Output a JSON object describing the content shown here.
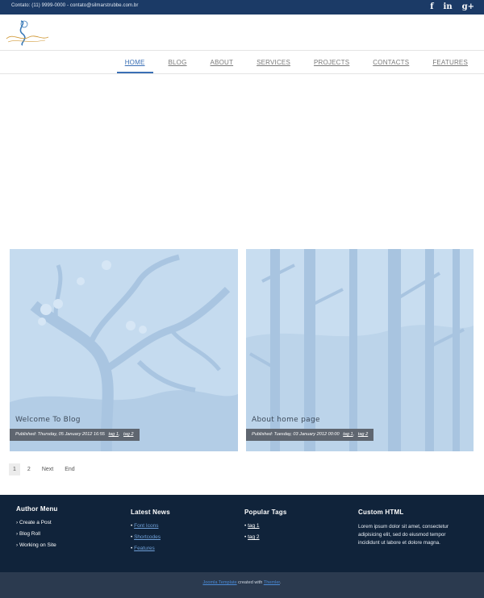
{
  "topbar": {
    "contact": "Contato: (11) 9999-0000  -  contato@silmarstrubbe.com.br",
    "social": [
      {
        "icon": "facebook-icon",
        "glyph": "f"
      },
      {
        "icon": "linkedin-icon",
        "glyph": "in"
      },
      {
        "icon": "google-plus-icon",
        "glyph": "g+"
      }
    ]
  },
  "nav": {
    "items": [
      "HOME",
      "BLOG",
      "ABOUT",
      "SERVICES",
      "PROJECTS",
      "CONTACTS",
      "FEATURES"
    ]
  },
  "posts": [
    {
      "title": "Welcome To Blog",
      "meta": "Published: Thursday, 05 January 2012 16:55",
      "tag1": "tag 1",
      "tag2": "tag 2"
    },
    {
      "title": "About home page",
      "meta": "Published: Tuesday, 03 January 2012 00:00",
      "tag1": "tag 1",
      "tag2": "tag 2"
    }
  ],
  "pagination": [
    "1",
    "2",
    "Next",
    "End"
  ],
  "footer": {
    "author_menu": {
      "title": "Author Menu",
      "items": [
        "Create a Post",
        "Blog Roll",
        "Working on Site"
      ]
    },
    "latest_news": {
      "title": "Latest News",
      "items": [
        "Font Icons",
        "Shortcodes",
        "Features"
      ]
    },
    "popular_tags": {
      "title": "Popular Tags",
      "items": [
        "tag 1",
        "tag 2"
      ]
    },
    "custom_html": {
      "title": "Custom HTML",
      "text": "Lorem ipsum dolor sit amet, consectetur adipisicing elit, sed do eiusmod tempor incididunt ut labore et dolore magna."
    }
  },
  "bottom": {
    "link1": "Joomla Template",
    "mid": " created with ",
    "link2": "Themler",
    "end": "."
  },
  "colors": {
    "topbar": "#1b3a66",
    "accent": "#3a6fb5",
    "footer": "#10233a",
    "bottombar": "#2b3a4f",
    "card": "#c4d9ee"
  }
}
